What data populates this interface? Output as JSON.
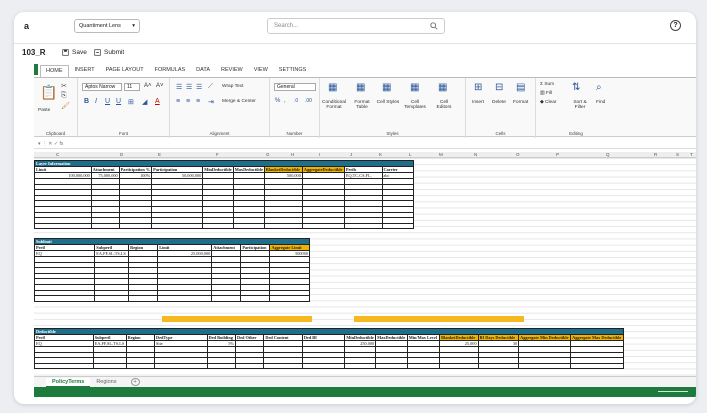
{
  "app": {
    "letter": "a",
    "workspace": "Quantiment Lens",
    "workspace_caret": "▾"
  },
  "search": {
    "placeholder": "Search...",
    "icon": "search-icon"
  },
  "help_icon": "?",
  "file": {
    "name": "103_R",
    "save_label": "Save",
    "submit_label": "Submit"
  },
  "ribbon_tabs": [
    "HOME",
    "INSERT",
    "PAGE LAYOUT",
    "FORMULAS",
    "DATA",
    "REVIEW",
    "VIEW",
    "SETTINGS"
  ],
  "ribbon": {
    "clipboard": {
      "label": "Clipboard",
      "paste": "Paste"
    },
    "font": {
      "label": "Font",
      "name": "Aptos Narrow",
      "size": "11"
    },
    "alignment": {
      "label": "Alignment",
      "wrap": "Wrap Text",
      "merge": "Merge & Center"
    },
    "number": {
      "label": "Number",
      "format": "General"
    },
    "styles": {
      "label": "Styles",
      "cond": "Conditional Format",
      "table": "Format Table",
      "cellstyles": "Cell Styles",
      "templates": "Cell Templates",
      "editors": "Cell Editors"
    },
    "cells": {
      "label": "Cells",
      "insert": "Insert",
      "delete": "Delete",
      "format": "Format"
    },
    "editing": {
      "label": "Editing",
      "sum": "Sum",
      "fill": "Fill",
      "clear": "Clear",
      "sort": "Sort & Filter",
      "find": "Find"
    }
  },
  "columns": [
    "C",
    "D",
    "E",
    "F",
    "G",
    "H",
    "I",
    "J",
    "K",
    "L",
    "M",
    "N",
    "O",
    "P",
    "Q",
    "R",
    "S",
    "T"
  ],
  "layer": {
    "title": "Layer Information",
    "headers": [
      "Limit",
      "Attachment",
      "Participation %",
      "Participation",
      "MinDeductible",
      "MaxDeductible",
      "BlanketDeductible",
      "AggregateDeductible",
      "Perils",
      "Carrier"
    ],
    "row": [
      "100,000,000",
      "75,000,000",
      "100%",
      "50,000,000",
      "",
      "",
      "500,000",
      "",
      "EQ,TC,CS,FL,",
      "abc"
    ]
  },
  "sublimit": {
    "title": "Sublimit",
    "headers": [
      "Peril",
      "Subperil",
      "Region",
      "Limit",
      "Attachment",
      "Participation",
      "Aggregate Limit"
    ],
    "row": [
      "EQ",
      "EA,FF,SL,TS,LS",
      "",
      "25,000,000",
      "",
      "",
      "500000"
    ]
  },
  "deductible": {
    "title": "Deductible",
    "headers": [
      "Peril",
      "Subperil",
      "Region",
      "DedType",
      "Ded Building",
      "Ded Other",
      "Ded Content",
      "Ded BI",
      "MinDeductible",
      "MaxDeductible",
      "Min/Max Level",
      "BlanketDeductible",
      "BI Days Deductible",
      "Aggregate Min Deductible",
      "Aggregate Max Deductible"
    ],
    "row": [
      "EQ",
      "EA,FF,SL,TS,LS",
      "",
      "Site",
      "5%",
      "",
      "",
      "",
      "250,000",
      "",
      "",
      "25,000",
      "30",
      "",
      ""
    ]
  },
  "sheets": [
    "PolicyTerms",
    "Regions"
  ],
  "add_sheet": "+",
  "colors": {
    "brand_green": "#1e7b3e",
    "table_header": "#1f6f8b",
    "highlight": "#f0b400"
  }
}
